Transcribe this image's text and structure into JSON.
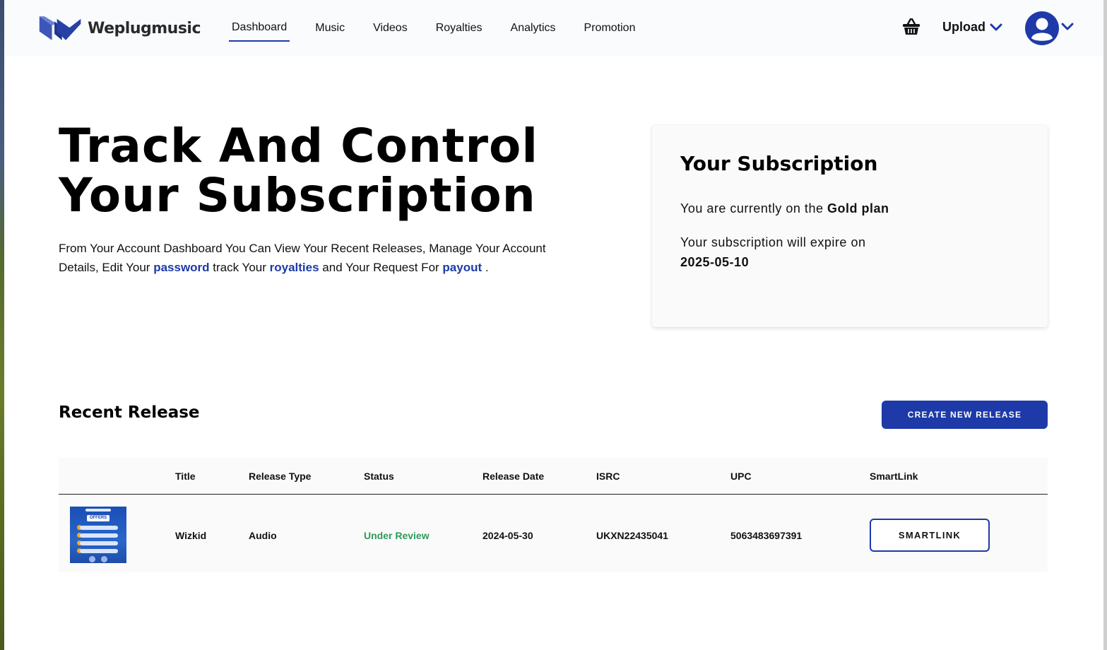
{
  "brand": {
    "name": "Weplugmusic",
    "accent": "#1d3aa8",
    "status_color": "#2e9b5a"
  },
  "nav": {
    "items": [
      {
        "label": "Dashboard",
        "active": true
      },
      {
        "label": "Music"
      },
      {
        "label": "Videos"
      },
      {
        "label": "Royalties"
      },
      {
        "label": "Analytics"
      },
      {
        "label": "Promotion"
      }
    ],
    "cart_icon": "basket-icon",
    "upload_label": "Upload",
    "avatar_icon": "user-avatar-icon"
  },
  "hero": {
    "title_line1": "Track And Control",
    "title_line2": "Your Subscription",
    "desc_part1": "From Your Account Dashboard You Can View Your Recent Releases, Manage Your Account Details, Edit Your ",
    "link_password": "password",
    "desc_part2": " track Your ",
    "link_royalties": "royalties",
    "desc_part3": " and Your Request For ",
    "link_payout": "payout",
    "desc_part4": " ."
  },
  "subscription": {
    "title": "Your Subscription",
    "plan_prefix": "You are currently on the ",
    "plan_name": "Gold plan",
    "expire_text": "Your subscription will expire on",
    "expire_date": "2025-05-10"
  },
  "releases": {
    "title": "Recent Release",
    "create_label": "CREATE NEW RELEASE",
    "columns": [
      "Title",
      "Release Type",
      "Status",
      "Release Date",
      "ISRC",
      "UPC",
      "SmartLink"
    ],
    "rows": [
      {
        "title": "Wizkid",
        "type": "Audio",
        "status": "Under Review",
        "release_date": "2024-05-30",
        "isrc": "UKXN22435041",
        "upc": "5063483697391",
        "smartlink_label": "SMARTLINK",
        "thumb_text": "OFFERS"
      }
    ]
  }
}
